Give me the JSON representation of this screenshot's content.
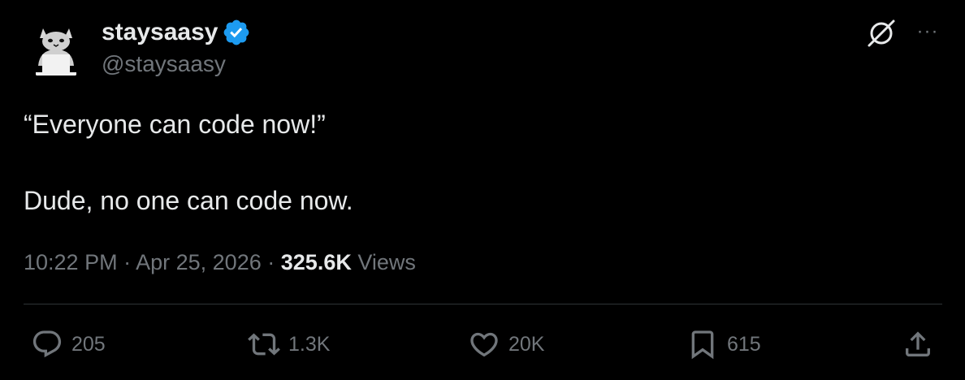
{
  "author": {
    "display_name": "staysaasy",
    "handle": "@staysaasy",
    "verified": true,
    "avatar_icon": "cat-with-laptop-avatar"
  },
  "tweet": {
    "lines": [
      "“Everyone can code now!”",
      "Dude, no one can code now."
    ]
  },
  "meta": {
    "time": "10:22 PM",
    "separator": "·",
    "date": "Apr 25, 2026",
    "views_count": "325.6K",
    "views_label": "Views"
  },
  "actions": {
    "replies": "205",
    "reposts": "1.3K",
    "likes": "20K",
    "bookmarks": "615"
  },
  "header_icons": [
    "grok-icon",
    "more-options-icon"
  ],
  "colors": {
    "background": "#000000",
    "text": "#e7e9ea",
    "secondary": "#71767b",
    "verified": "#1d9bf0",
    "divider": "#2f3336"
  }
}
